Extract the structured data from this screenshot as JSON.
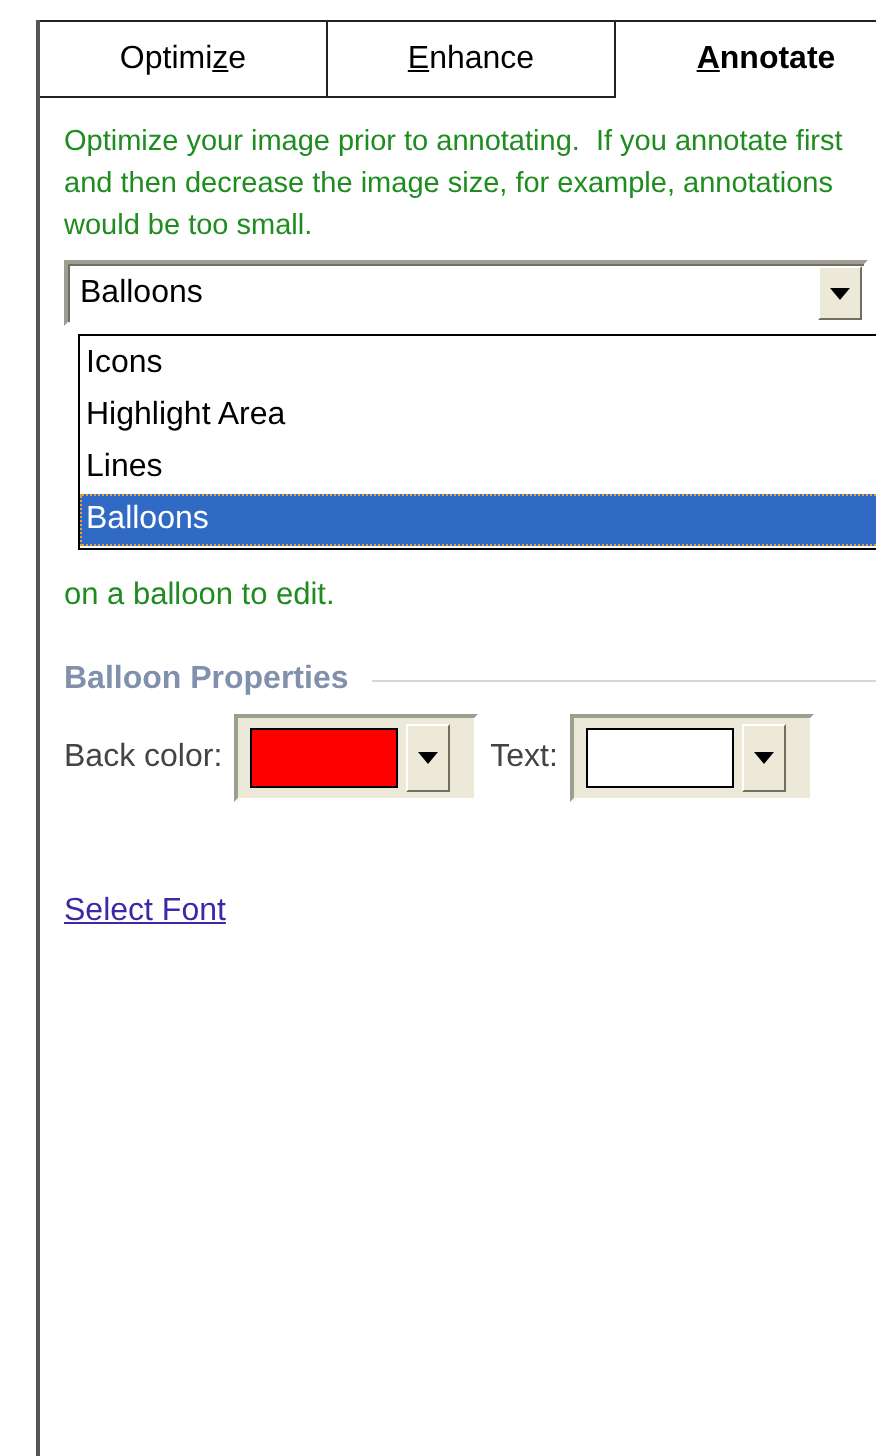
{
  "tabs": [
    {
      "label": {
        "before": "Optimi",
        "access_key": "z",
        "after": "e"
      },
      "selected": false
    },
    {
      "label": {
        "access_key": "E",
        "after": "nhance"
      },
      "selected": false
    },
    {
      "label": {
        "access_key": "A",
        "after": "nnotate"
      },
      "selected": true
    }
  ],
  "description": "Optimize your image prior to annotating.  If you annotate first and then decrease the image size, for example, annotations would be too small.",
  "annotation_type": {
    "value": "Balloons",
    "expanded": true,
    "options": [
      {
        "label": "Icons",
        "selected": false
      },
      {
        "label": "Highlight Area",
        "selected": false
      },
      {
        "label": "Lines",
        "selected": false
      },
      {
        "label": "Balloons",
        "selected": true
      }
    ]
  },
  "hint": "on a balloon to edit.",
  "balloon_properties": {
    "title": "Balloon Properties",
    "back_color": {
      "label": "Back color:",
      "color": "#ff0000"
    },
    "text_color": {
      "label": "Text:",
      "color": "#ffffff"
    }
  },
  "select_font_link": "Select Font"
}
